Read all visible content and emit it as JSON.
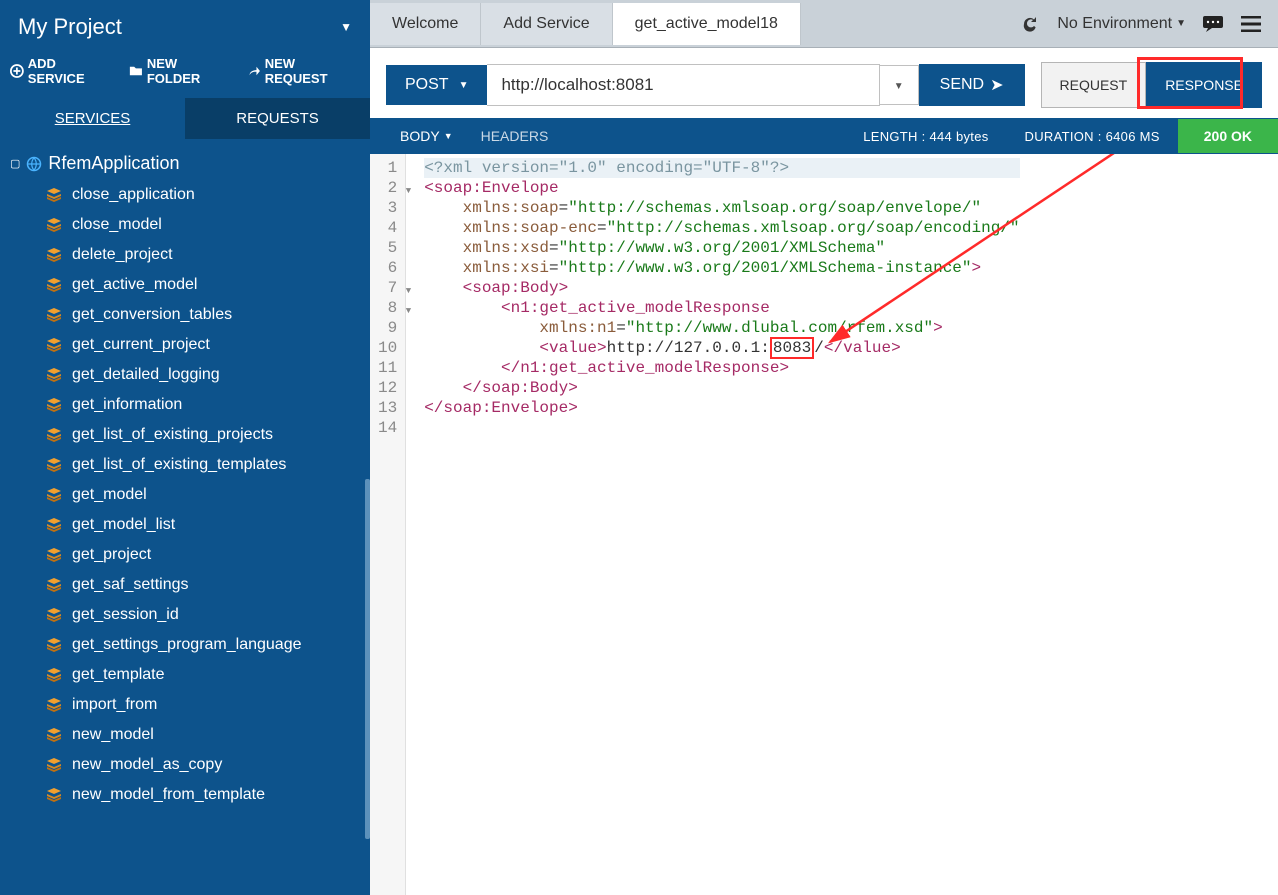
{
  "project": {
    "title": "My Project"
  },
  "sidebarActions": {
    "addService": "ADD SERVICE",
    "newFolder": "NEW FOLDER",
    "newRequest": "NEW REQUEST"
  },
  "sidebarTabs": {
    "services": "SERVICES",
    "requests": "REQUESTS"
  },
  "tree": {
    "root": "RfemApplication",
    "items": [
      "close_application",
      "close_model",
      "delete_project",
      "get_active_model",
      "get_conversion_tables",
      "get_current_project",
      "get_detailed_logging",
      "get_information",
      "get_list_of_existing_projects",
      "get_list_of_existing_templates",
      "get_model",
      "get_model_list",
      "get_project",
      "get_saf_settings",
      "get_session_id",
      "get_settings_program_language",
      "get_template",
      "import_from",
      "new_model",
      "new_model_as_copy",
      "new_model_from_template"
    ]
  },
  "topTabs": {
    "welcome": "Welcome",
    "addService": "Add Service",
    "active": "get_active_model18"
  },
  "topRight": {
    "env": "No Environment"
  },
  "request": {
    "method": "POST",
    "url": "http://localhost:8081",
    "send": "SEND"
  },
  "reqresp": {
    "request": "REQUEST",
    "response": "RESPONSE"
  },
  "responseHeader": {
    "body": "BODY",
    "headers": "HEADERS",
    "length": "LENGTH : 444 bytes",
    "duration": "DURATION : 6406 MS",
    "status": "200 OK"
  },
  "code": {
    "lineCount": 14,
    "xmlDecl": "<?xml version=\"1.0\" encoding=\"UTF-8\"?>",
    "nsSoap": "\"http://schemas.xmlsoap.org/soap/envelope/\"",
    "nsSoapEnc": "\"http://schemas.xmlsoap.org/soap/encoding/\"",
    "nsXsd": "\"http://www.w3.org/2001/XMLSchema\"",
    "nsXsi": "\"http://www.w3.org/2001/XMLSchema-instance\"",
    "nsN1": "\"http://www.dlubal.com/rfem.xsd\"",
    "valuePre": "http://127.0.0.1:",
    "valuePort": "8083",
    "valuePost": "/"
  }
}
